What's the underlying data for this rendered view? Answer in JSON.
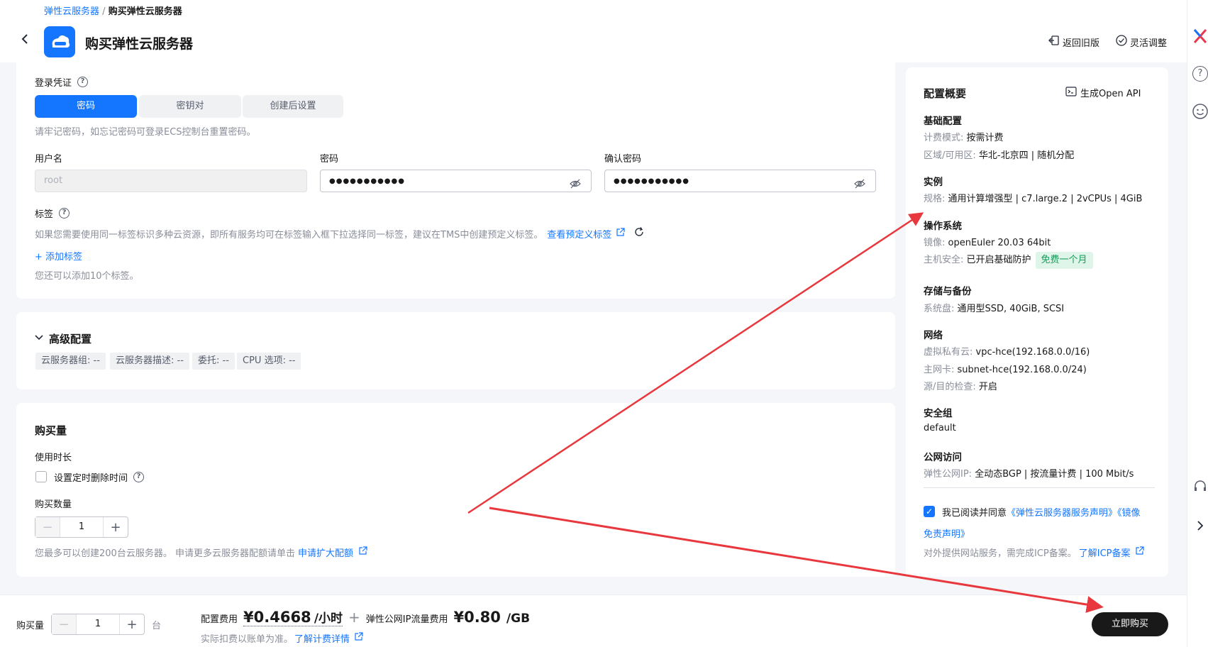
{
  "breadcrumb": {
    "parent": "弹性云服务器",
    "sep": "/",
    "current": "购买弹性云服务器"
  },
  "header": {
    "title": "购买弹性云服务器",
    "back_old": "返回旧版",
    "flex_adjust": "灵活调整"
  },
  "login": {
    "label": "登录凭证",
    "tabs": [
      "密码",
      "密钥对",
      "创建后设置"
    ],
    "hint": "请牢记密码，如忘记密码可登录ECS控制台重置密码。",
    "username_label": "用户名",
    "username_value": "root",
    "password_label": "密码",
    "password_value": "●●●●●●●●●●●",
    "confirm_label": "确认密码",
    "confirm_value": "●●●●●●●●●●●"
  },
  "tags": {
    "label": "标签",
    "hint": "如果您需要使用同一标签标识多种云资源，即所有服务均可在标签输入框下拉选择同一标签，建议在TMS中创建预定义标签。",
    "view_link": "查看预定义标签",
    "add": "+ 添加标签",
    "remain": "您还可以添加10个标签。"
  },
  "advanced": {
    "title": "高级配置",
    "chips": [
      "云服务器组: --",
      "云服务器描述: --",
      "委托: --",
      "CPU 选项: --"
    ]
  },
  "purchase": {
    "title": "购买量",
    "duration_label": "使用时长",
    "timed_delete": "设置定时删除时间",
    "qty_label": "购买数量",
    "qty": "1",
    "quota_hint": "您最多可以创建200台云服务器。 申请更多云服务器配额请单击",
    "quota_link": "申请扩大配额"
  },
  "summary": {
    "title": "配置概要",
    "api": "生成Open API",
    "basic_h": "基础配置",
    "billing_k": "计费模式: ",
    "billing_v": "按需计费",
    "region_k": "区域/可用区: ",
    "region_v": "华北-北京四 | 随机分配",
    "instance_h": "实例",
    "spec_k": "规格: ",
    "spec_v": "通用计算增强型 | c7.large.2 | 2vCPUs | 4GiB",
    "os_h": "操作系统",
    "image_k": "镜像: ",
    "image_v": "openEuler 20.03 64bit",
    "hostsec_k": "主机安全: ",
    "hostsec_v": "已开启基础防护",
    "free_badge": "免费一个月",
    "storage_h": "存储与备份",
    "disk_k": "系统盘: ",
    "disk_v": "通用型SSD, 40GiB, SCSI",
    "network_h": "网络",
    "vpc_k": "虚拟私有云: ",
    "vpc_v": "vpc-hce(192.168.0.0/16)",
    "nic_k": "主网卡: ",
    "nic_v": "subnet-hce(192.168.0.0/24)",
    "srccheck_k": "源/目的检查: ",
    "srccheck_v": "开启",
    "sg_h": "安全组",
    "sg_v": "default",
    "public_h": "公网访问",
    "eip_k": "弹性公网IP: ",
    "eip_v": "全动态BGP | 按流量计费 | 100 Mbit/s",
    "agree_a": "我已阅读并同意",
    "agree_link1": "《弹性云服务器服务声明》《镜像",
    "agree_link2": "免责声明》",
    "icp_hint": "对外提供网站服务，需完成ICP备案。",
    "icp_link": "了解ICP备案"
  },
  "footer": {
    "qty_label": "购买量",
    "qty": "1",
    "unit": "台",
    "config_fee_label": "配置费用",
    "config_fee": "¥0.4668",
    "config_unit": "/小时",
    "plus": "+",
    "eip_fee_label": "弹性公网IP流量费用",
    "eip_fee": "¥0.80",
    "eip_unit": "/GB",
    "note": "实际扣费以账单为准。",
    "note_link": "了解计费详情",
    "buy": "立即购买"
  }
}
